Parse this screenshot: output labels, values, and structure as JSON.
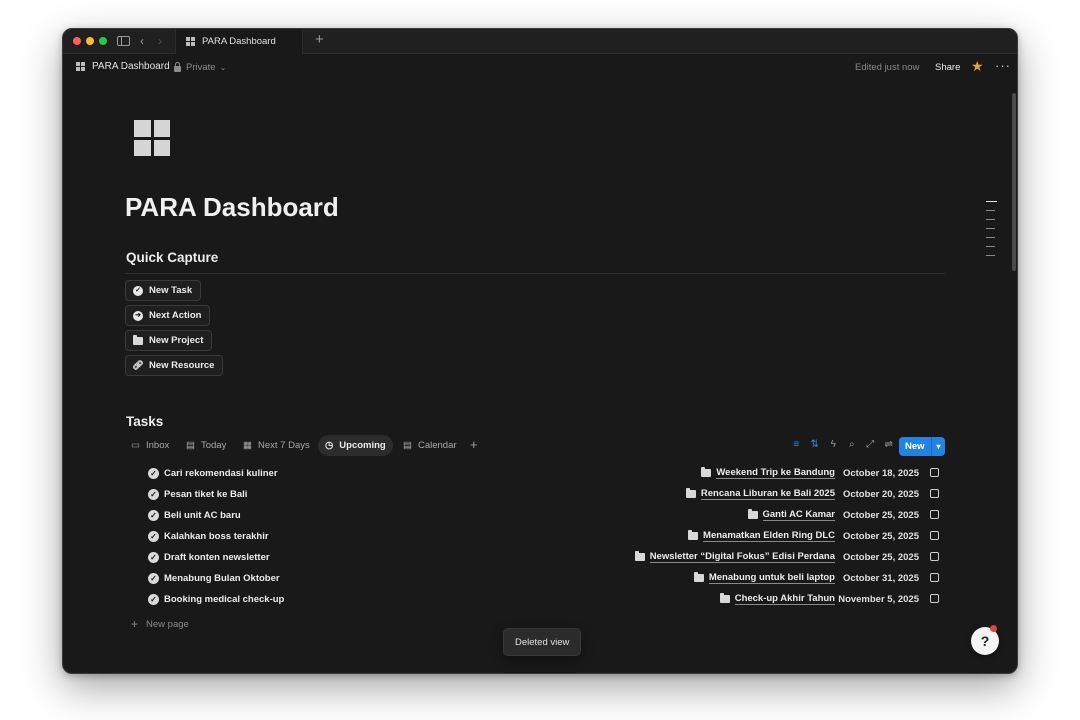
{
  "window": {
    "tab_title": "PARA Dashboard",
    "new_tab": "+"
  },
  "header": {
    "breadcrumb": "PARA Dashboard",
    "privacy": "Private",
    "edited": "Edited just now",
    "share": "Share",
    "more": "···"
  },
  "page": {
    "title": "PARA Dashboard"
  },
  "quick_capture": {
    "heading": "Quick Capture",
    "buttons": [
      {
        "label": "New Task"
      },
      {
        "label": "Next Action"
      },
      {
        "label": "New Project"
      },
      {
        "label": "New Resource"
      }
    ]
  },
  "tasks": {
    "heading": "Tasks",
    "views": [
      {
        "label": "Inbox",
        "icon": "inbox-icon"
      },
      {
        "label": "Today",
        "icon": "calendar-icon"
      },
      {
        "label": "Next 7 Days",
        "icon": "calendar-grid-icon"
      },
      {
        "label": "Upcoming",
        "icon": "clock-icon",
        "active": true
      },
      {
        "label": "Calendar",
        "icon": "calendar-icon"
      }
    ],
    "add_view": "+",
    "new_button": "New",
    "rows": [
      {
        "title": "Cari rekomendasi kuliner",
        "project": "Weekend Trip ke Bandung",
        "date": "October 18, 2025"
      },
      {
        "title": "Pesan tiket ke Bali",
        "project": "Rencana Liburan ke Bali 2025",
        "date": "October 20, 2025"
      },
      {
        "title": "Beli unit AC baru",
        "project": "Ganti AC Kamar",
        "date": "October 25, 2025"
      },
      {
        "title": "Kalahkan boss terakhir",
        "project": "Menamatkan Elden Ring DLC",
        "date": "October 25, 2025"
      },
      {
        "title": "Draft konten newsletter",
        "project": "Newsletter “Digital Fokus” Edisi Perdana",
        "date": "October 25, 2025"
      },
      {
        "title": "Menabung Bulan Oktober",
        "project": "Menabung untuk beli laptop",
        "date": "October 31, 2025"
      },
      {
        "title": "Booking medical check-up",
        "project": "Check-up Akhir Tahun",
        "date": "November 5, 2025"
      }
    ],
    "new_page": "New page"
  },
  "toast": "Deleted view",
  "help_glyph": "?",
  "colors": {
    "background": "#191919",
    "accent": "#2383e2",
    "star": "#e8a33d"
  }
}
